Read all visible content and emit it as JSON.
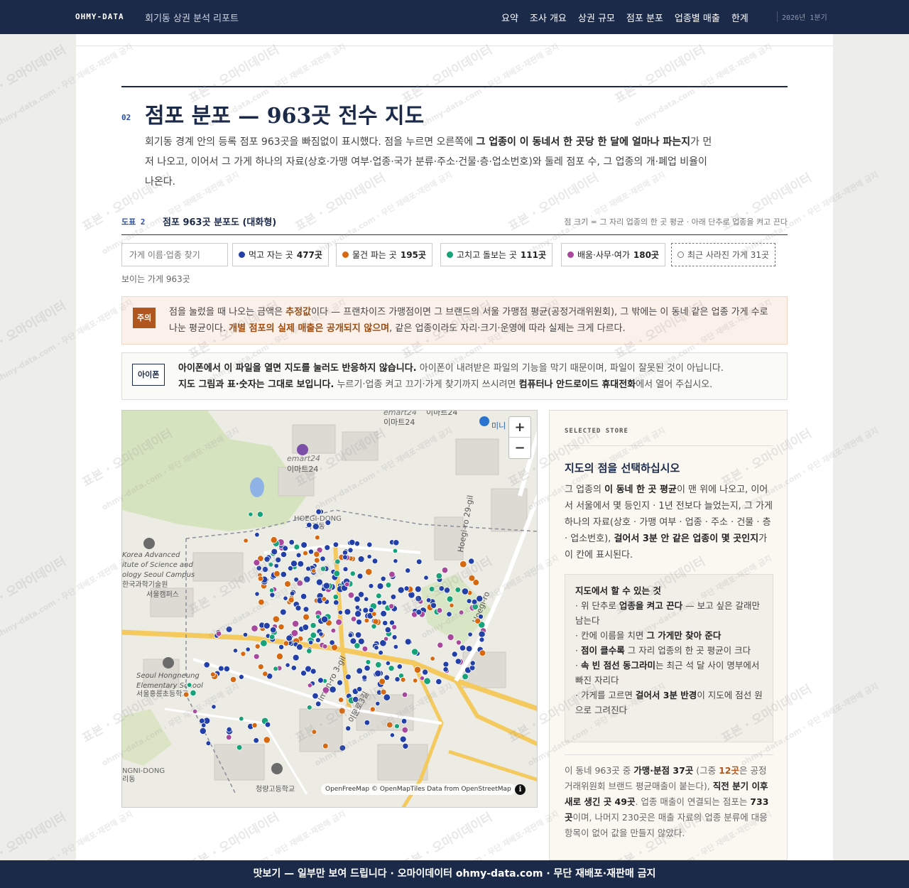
{
  "topbar": {
    "brand": "OHMY-DATA",
    "report_title": "회기동 상권 분석 리포트",
    "nav": [
      "요약",
      "조사 개요",
      "상권 규모",
      "점포 분포",
      "업종별 매출",
      "한계"
    ],
    "period": "2026년 1분기"
  },
  "section": {
    "number": "02",
    "title": "점포 분포 — 963곳 전수 지도",
    "lead_1": "회기동 경계 안의 등록 점포 963곳을 빠짐없이 표시했다. 점을 누르면 오른쪽에 ",
    "lead_bold": "그 업종이 이 동네서 한 곳당 한 달에 얼마나 파는지",
    "lead_2": "가 먼저 나오고, 이어서 그 가게 하나의 자료(상호·가맹 여부·업종·국가 분류·주소·건물·층·업소번호)와 둘레 점포 수, 그 업종의 개·폐업 비율이 나온다."
  },
  "figure": {
    "label": "도표 2",
    "title": "점포 963곳 분포도 (대화형)",
    "note": "점 크기 = 그 자리 업종의 한 곳 평균 · 아래 단추로 업종을 켜고 끈다"
  },
  "controls": {
    "search_placeholder": "가게 이름·업종 찾기",
    "chips": [
      {
        "label": "먹고 자는 곳",
        "count": "477곳",
        "color": "#2340a8"
      },
      {
        "label": "물건 파는 곳",
        "count": "195곳",
        "color": "#d6680f"
      },
      {
        "label": "고치고 돌보는 곳",
        "count": "111곳",
        "color": "#16a37a"
      },
      {
        "label": "배움·사무·여가",
        "count": "180곳",
        "color": "#a8479c"
      },
      {
        "label": "최근 사라진 가게 31곳",
        "count": "",
        "color": "#777777"
      }
    ],
    "visible_count": "보이는 가게 963곳"
  },
  "notice_caution": {
    "tag": "주의",
    "t1": "점을 눌렀을 때 나오는 금액은 ",
    "h1": "추정값",
    "t2": "이다 — 프랜차이즈 가맹점이면 그 브랜드의 서울 가맹점 평균(공정거래위원회), 그 밖에는 이 동네 같은 업종 가게 수로 나눈 평균이다. ",
    "h2": "개별 점포의 실제 매출은 공개되지 않으며",
    "t3": ", 같은 업종이라도 자리·크기·운영에 따라 실제는 크게 다르다."
  },
  "notice_iphone": {
    "tag": "아이폰",
    "b1": "아이폰에서 이 파일을 열면 지도를 눌러도 반응하지 않습니다.",
    "t1": " 아이폰이 내려받은 파일의 기능을 막기 때문이며, 파일이 잘못된 것이 아닙니다.",
    "b2": "지도 그림과 표·숫자는 그대로 보입니다.",
    "t2": " 누르기·업종 켜고 끄기·가게 찾기까지 쓰시려면 ",
    "b3": "컴퓨터나 안드로이드 휴대전화",
    "t3": "에서 열어 주십시오."
  },
  "map": {
    "labels": {
      "emart_top": "emart24",
      "emart_top_ko": "이마트24",
      "emart_mid": "emart24",
      "emart_mid_ko": "이마트24",
      "hoegi_en": "HOEGI-DONG",
      "hoegi_ko": "회기동",
      "kaist_1": "Korea Advanced",
      "kaist_2": "itute of Science and",
      "kaist_3": "ology Seoul Campus",
      "kaist_4": "한국과학기술원",
      "kaist_5": "서울캠퍼스",
      "school_en1": "Seoul Hongneung",
      "school_en2": "Elementary School",
      "school_ko": "서울홍릉초등학교",
      "road_1": "Imun-ro 3-gil",
      "road_1_ko": "이문로3길",
      "road_2": "Hoegi-ro",
      "road_3": "Hoegi-ro 29-gil",
      "cheongnyangni_en": "NGNI-DONG",
      "cheongnyangni_ko": "리동",
      "high_school": "청량고등학교",
      "mini": "미니"
    },
    "zoom_in": "+",
    "zoom_out": "−",
    "attribution": "OpenFreeMap © OpenMapTiles Data from OpenStreetMap",
    "info": "i"
  },
  "panel": {
    "eyebrow": "SELECTED STORE",
    "title": "지도의 점을 선택하십시오",
    "p1": "그 업종의 ",
    "p1b": "이 동네 한 곳 평균",
    "p2": "이 맨 위에 나오고, 이어서 서울에서 몇 등인지 · 1년 전보다 늘었는지, 그 가게 하나의 자료(상호 · 가맹 여부 · 업종 · 주소 · 건물 · 층 · 업소번호), ",
    "p2b": "걸어서 3분 안 같은 업종이 몇 곳인지",
    "p3": "가 이 칸에 표시된다.",
    "howto_title": "지도에서 할 수 있는 것",
    "howto": [
      {
        "pre": "· 위 단추로 ",
        "b": "업종을 켜고 끈다",
        "post": " — 보고 싶은 갈래만 남는다"
      },
      {
        "pre": "· 칸에 이름을 치면 ",
        "b": "그 가게만 찾아 준다",
        "post": ""
      },
      {
        "pre": "· ",
        "b": "점이 클수록",
        "post": " 그 자리 업종의 한 곳 평균이 크다"
      },
      {
        "pre": "· ",
        "b": "속 빈 점선 동그라미",
        "post": "는 최근 석 달 사이 명부에서 빠진 자리다"
      },
      {
        "pre": "· 가게를 고르면 ",
        "b": "걸어서 3분 반경",
        "post": "이 지도에 점선 원으로 그려진다"
      }
    ],
    "s1": "이 동네 963곳 중 ",
    "s1b": "가맹·분점 37곳",
    "s2": " (그중 ",
    "s2o": "12곳",
    "s3": "은 공정거래위원회 브랜드 평균매출이 붙는다), ",
    "s3b": "직전 분기 이후 새로 생긴 곳 49곳",
    "s4": ". 업종 매출이 연결되는 점포는 ",
    "s4b": "733곳",
    "s5": "이며, 나머지 230곳은 매출 자료의 업종 분류에 대응 항목이 없어 값을 만들지 않았다."
  },
  "footer": "맛보기 — 일부만 보여 드립니다 · 오마이데이터 ohmy-data.com · 무단 재배포·재판매 금지",
  "watermark": {
    "main": "표본 · 오마이데이터",
    "small": "ohmy-data.com · 무단 재배포·재판매 금지"
  }
}
